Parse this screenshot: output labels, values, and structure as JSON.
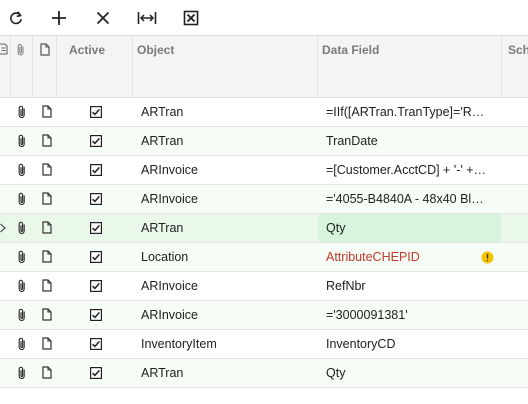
{
  "toolbar": {
    "buttons": [
      {
        "name": "refresh-button",
        "icon": "refresh-icon"
      },
      {
        "name": "add-row-button",
        "icon": "plus-icon"
      },
      {
        "name": "delete-row-button",
        "icon": "close-icon"
      },
      {
        "name": "fit-columns-button",
        "icon": "fit-width-icon"
      },
      {
        "name": "export-excel-button",
        "icon": "excel-icon"
      }
    ]
  },
  "grid": {
    "columns": {
      "active": "Active",
      "object": "Object",
      "data_field": "Data Field",
      "schema": "Sch"
    },
    "rows": [
      {
        "active": true,
        "object": "ARTran",
        "data_field": "=IIf([ARTran.TranType]='R…",
        "status": "normal"
      },
      {
        "active": true,
        "object": "ARTran",
        "data_field": "TranDate",
        "status": "normal"
      },
      {
        "active": true,
        "object": "ARInvoice",
        "data_field": "=[Customer.AcctCD] + '-' +…",
        "status": "normal"
      },
      {
        "active": true,
        "object": "ARInvoice",
        "data_field": "='4055-B4840A - 48x40 Bl…",
        "status": "normal"
      },
      {
        "active": true,
        "object": "ARTran",
        "data_field": "Qty",
        "status": "selected"
      },
      {
        "active": true,
        "object": "Location",
        "data_field": "AttributeCHEPID",
        "status": "warning"
      },
      {
        "active": true,
        "object": "ARInvoice",
        "data_field": "RefNbr",
        "status": "normal"
      },
      {
        "active": true,
        "object": "ARInvoice",
        "data_field": "='3000091381'",
        "status": "normal"
      },
      {
        "active": true,
        "object": "InventoryItem",
        "data_field": "InventoryCD",
        "status": "normal"
      },
      {
        "active": true,
        "object": "ARTran",
        "data_field": "Qty",
        "status": "normal"
      }
    ]
  },
  "colors": {
    "warning_text": "#c0392b",
    "warning_badge": "#f5c400",
    "selected_row": "#eaf8ea",
    "selected_cell": "#d6f5dc"
  }
}
